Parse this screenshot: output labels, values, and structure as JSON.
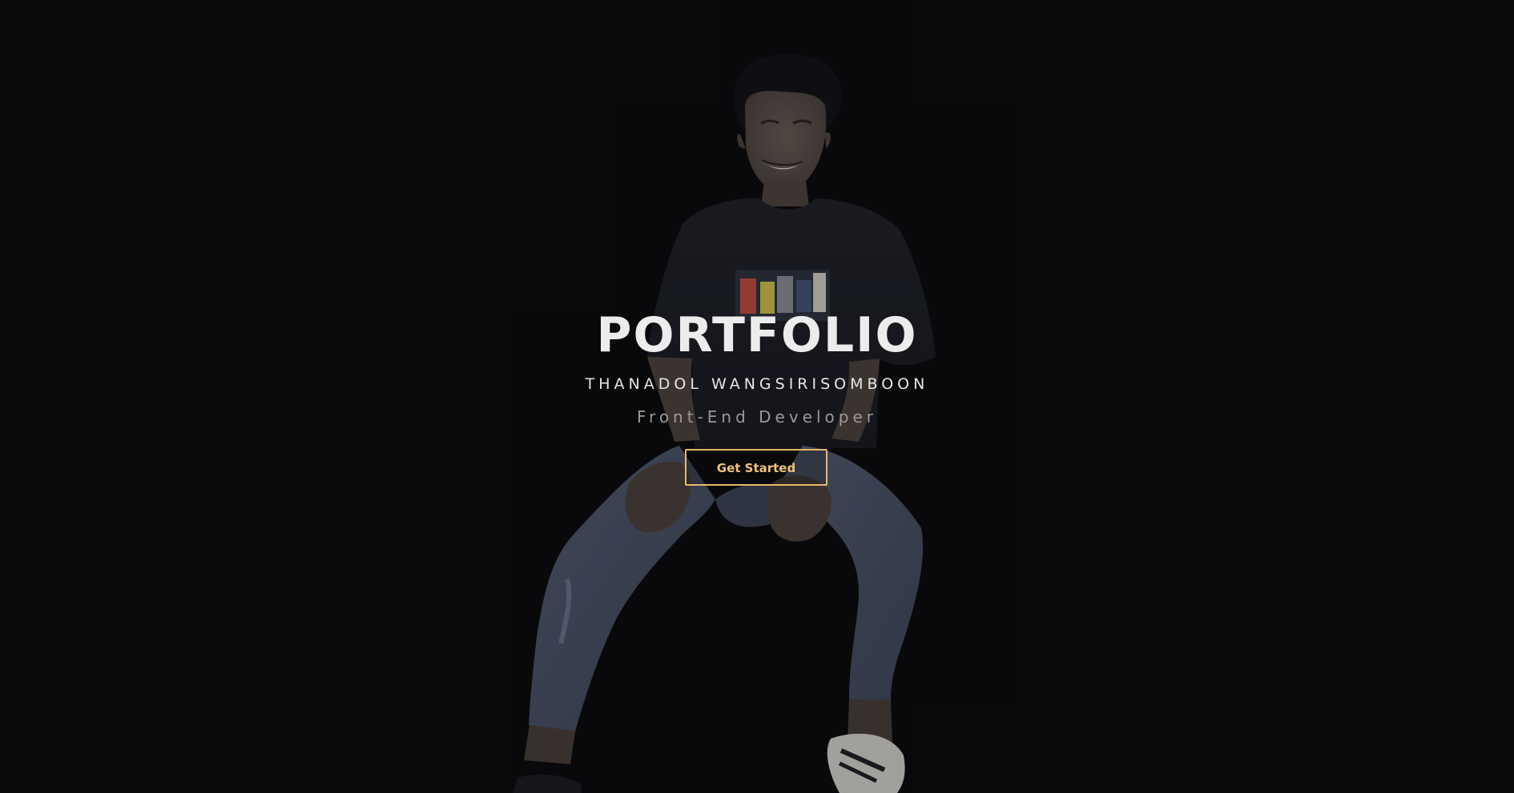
{
  "hero": {
    "title": "PORTFOLIO",
    "name": "THANADOL WANGSIRISOMBOON",
    "role": "Front-End Developer",
    "cta_label": "Get Started"
  },
  "colors": {
    "background": "#0b0b0c",
    "title": "#ececec",
    "subtitle": "#e6e6e6",
    "role": "#9a9a9a",
    "accent": "#e8b86a"
  }
}
